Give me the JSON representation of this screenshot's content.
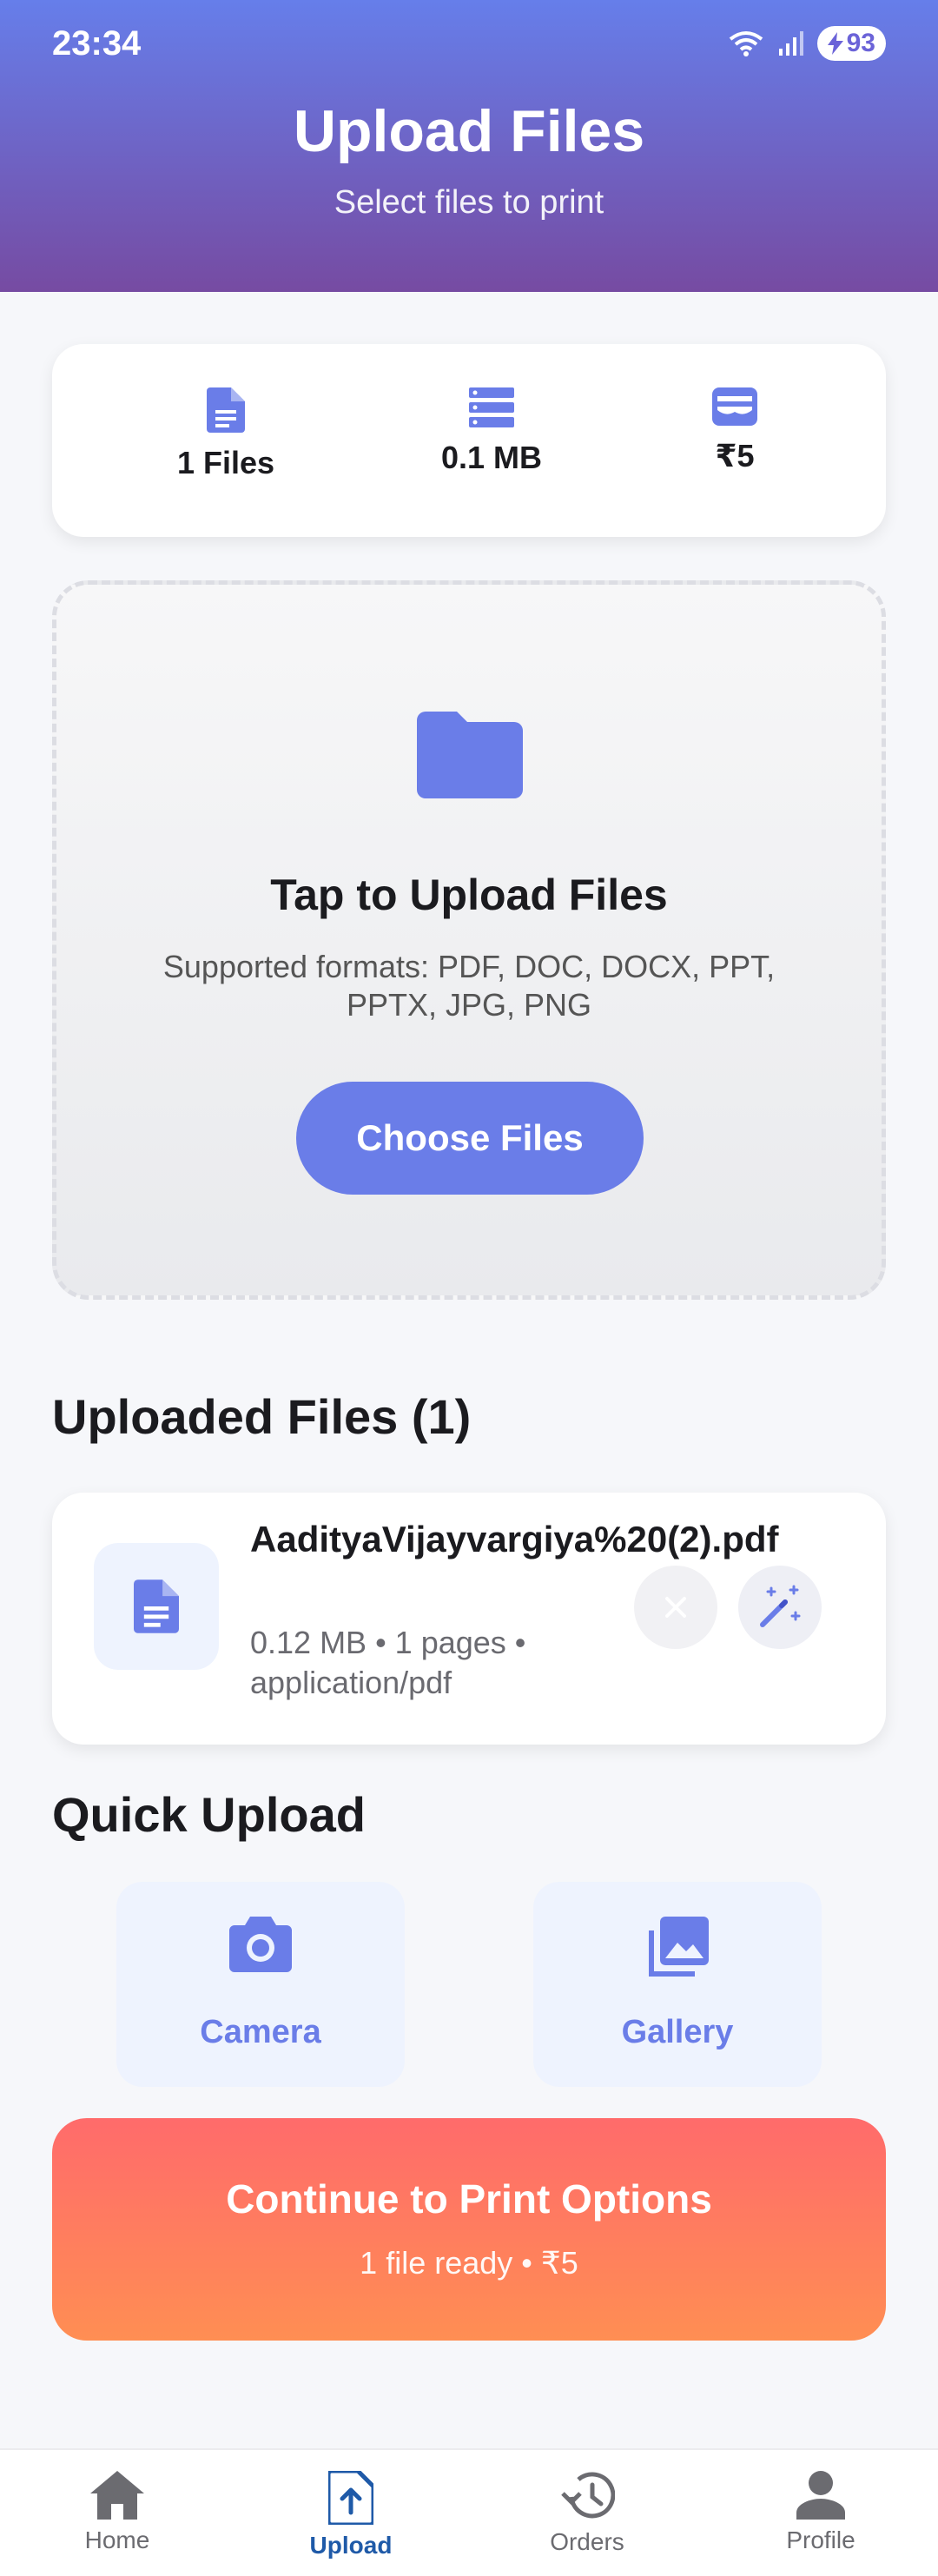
{
  "status_bar": {
    "time": "23:34",
    "battery": "93"
  },
  "header": {
    "title": "Upload Files",
    "subtitle": "Select files to print"
  },
  "stats": [
    {
      "icon": "document-icon",
      "label": "1 Files"
    },
    {
      "icon": "storage-icon",
      "label": "0.1 MB"
    },
    {
      "icon": "wallet-icon",
      "label": "₹5"
    }
  ],
  "upload_zone": {
    "icon": "folder-icon",
    "title": "Tap to Upload Files",
    "formats": "Supported formats: PDF, DOC, DOCX, PPT, PPTX, JPG, PNG",
    "button_label": "Choose Files"
  },
  "uploaded": {
    "section_title": "Uploaded Files (1)",
    "files": [
      {
        "name": "AadityaVijayvargiya%20(2).pdf",
        "meta": "0.12 MB • 1 pages • application/pdf"
      }
    ]
  },
  "quick_upload": {
    "section_title": "Quick Upload",
    "items": [
      {
        "icon": "camera-icon",
        "label": "Camera"
      },
      {
        "icon": "gallery-icon",
        "label": "Gallery"
      }
    ]
  },
  "continue": {
    "title": "Continue to Print Options",
    "subtitle": "1 file ready • ₹5"
  },
  "bottom_nav": [
    {
      "icon": "home-icon",
      "label": "Home",
      "active": false
    },
    {
      "icon": "upload-icon",
      "label": "Upload",
      "active": true
    },
    {
      "icon": "history-icon",
      "label": "Orders",
      "active": false
    },
    {
      "icon": "person-icon",
      "label": "Profile",
      "active": false
    }
  ],
  "colors": {
    "accent": "#6a7de8",
    "header_start": "#667eea",
    "header_end": "#764ba2",
    "cta_start": "#ff6b6b",
    "cta_end": "#ff8e53",
    "nav_active": "#1f5aa8"
  }
}
